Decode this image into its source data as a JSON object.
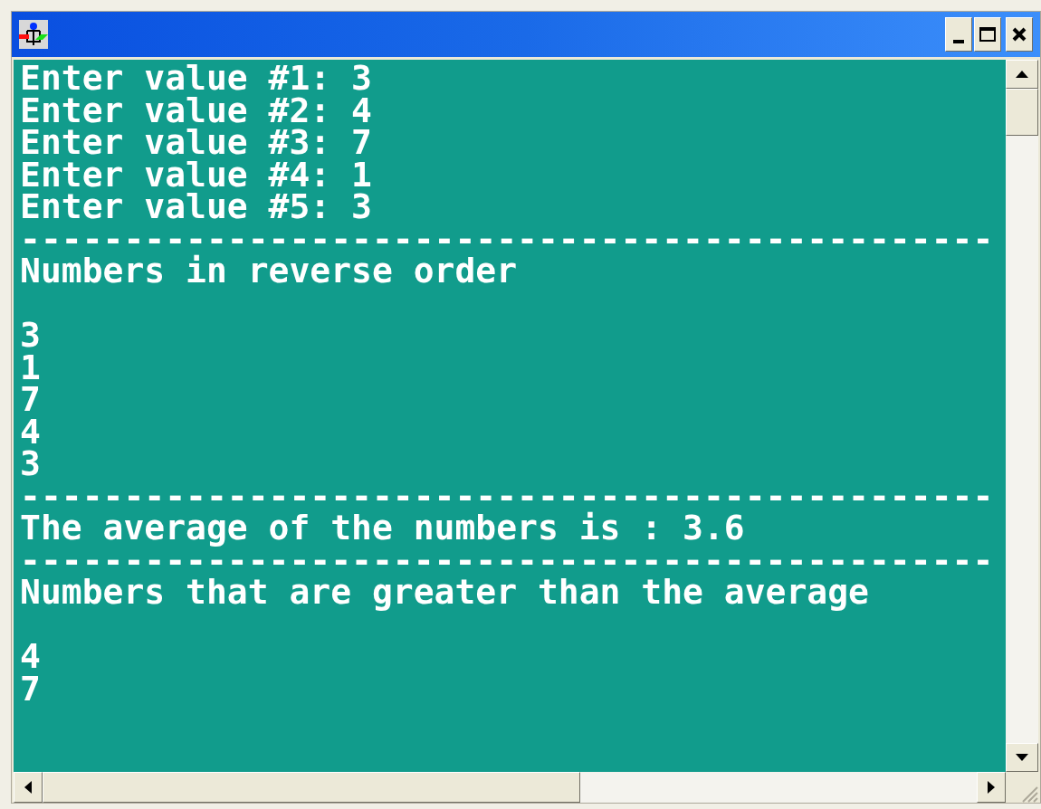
{
  "console": {
    "lines": [
      {
        "kind": "text",
        "text": "Enter value #1: 3"
      },
      {
        "kind": "text",
        "text": "Enter value #2: 4"
      },
      {
        "kind": "text",
        "text": "Enter value #3: 7"
      },
      {
        "kind": "text",
        "text": "Enter value #4: 1"
      },
      {
        "kind": "text",
        "text": "Enter value #5: 3"
      },
      {
        "kind": "text",
        "text": "-----------------------------------------------"
      },
      {
        "kind": "text",
        "text": "Numbers in reverse order"
      },
      {
        "kind": "blank"
      },
      {
        "kind": "text",
        "text": "3"
      },
      {
        "kind": "text",
        "text": "1"
      },
      {
        "kind": "text",
        "text": "7"
      },
      {
        "kind": "text",
        "text": "4"
      },
      {
        "kind": "text",
        "text": "3"
      },
      {
        "kind": "text",
        "text": "-----------------------------------------------"
      },
      {
        "kind": "text",
        "text": "The average of the numbers is : 3.6"
      },
      {
        "kind": "text",
        "text": "-----------------------------------------------"
      },
      {
        "kind": "text",
        "text": "Numbers that are greater than the average"
      },
      {
        "kind": "blank"
      },
      {
        "kind": "text",
        "text": "4"
      },
      {
        "kind": "text",
        "text": "7"
      }
    ]
  }
}
